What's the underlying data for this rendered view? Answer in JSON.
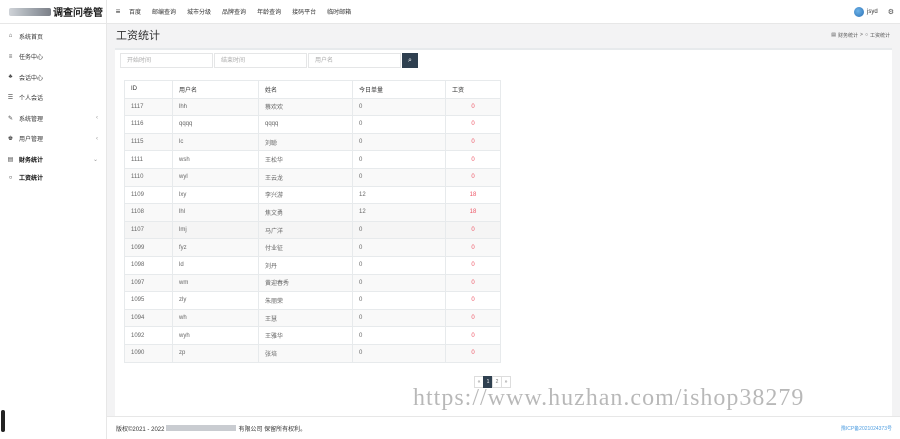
{
  "app": {
    "title": "调查问卷管"
  },
  "topnav": {
    "items": [
      "百度",
      "邮编查询",
      "城市分级",
      "品牌查询",
      "年龄查询",
      "接码平台",
      "临时邮箱"
    ],
    "username": "jsyd"
  },
  "sidebar": {
    "items": [
      {
        "icon": "home-icon",
        "glyph": "⌂",
        "label": "系统首页",
        "arrow": ""
      },
      {
        "icon": "list-icon",
        "glyph": "≡",
        "label": "任务中心",
        "arrow": ""
      },
      {
        "icon": "users-icon",
        "glyph": "♣",
        "label": "会话中心",
        "arrow": ""
      },
      {
        "icon": "list-alt-icon",
        "glyph": "☰",
        "label": "个人会话",
        "arrow": ""
      },
      {
        "icon": "wrench-icon",
        "glyph": "✎",
        "label": "系统管理",
        "arrow": "‹"
      },
      {
        "icon": "users-manage-icon",
        "glyph": "♚",
        "label": "用户管理",
        "arrow": "‹"
      },
      {
        "icon": "finance-icon",
        "glyph": "▤",
        "label": "财务统计",
        "arrow": "⌄"
      }
    ],
    "submenu": [
      {
        "icon": "circle-icon",
        "glyph": "○",
        "label": "工资统计"
      }
    ]
  },
  "page": {
    "title": "工资统计",
    "breadcrumb": {
      "parent": "财务统计",
      "sep": ">",
      "current": "工资统计"
    }
  },
  "search": {
    "start_placeholder": "开始时间",
    "end_placeholder": "结束时间",
    "user_placeholder": "用户名"
  },
  "table": {
    "headers": [
      "ID",
      "用户名",
      "姓名",
      "今日单量",
      "工资"
    ],
    "rows": [
      [
        "1117",
        "lhh",
        "蔡欢欢",
        "0",
        "0"
      ],
      [
        "1116",
        "qqqq",
        "qqqq",
        "0",
        "0"
      ],
      [
        "1115",
        "lc",
        "刘聪",
        "0",
        "0"
      ],
      [
        "1111",
        "wsh",
        "王松华",
        "0",
        "0"
      ],
      [
        "1110",
        "wyl",
        "王云龙",
        "0",
        "0"
      ],
      [
        "1109",
        "lxy",
        "李兴游",
        "12",
        "18"
      ],
      [
        "1108",
        "lhl",
        "焦文勇",
        "12",
        "18"
      ],
      [
        "1107",
        "lmj",
        "马广洋",
        "0",
        "0"
      ],
      [
        "1099",
        "fyz",
        "付业征",
        "0",
        "0"
      ],
      [
        "1098",
        "ld",
        "刘丹",
        "0",
        "0"
      ],
      [
        "1097",
        "wm",
        "黄迎春秀",
        "0",
        "0"
      ],
      [
        "1095",
        "zly",
        "朱丽荣",
        "0",
        "0"
      ],
      [
        "1094",
        "wh",
        "王慧",
        "0",
        "0"
      ],
      [
        "1092",
        "wyh",
        "王雅华",
        "0",
        "0"
      ],
      [
        "1090",
        "zp",
        "张培",
        "0",
        "0"
      ]
    ]
  },
  "pagination": {
    "prev": "«",
    "pages": [
      "1",
      "2"
    ],
    "current": "1",
    "next": "»"
  },
  "watermark": "https://www.huzhan.com/ishop38279",
  "footer": {
    "copyright_prefix": "版权©2021 - 2022",
    "copyright_suffix": "有限公司 保留所有权利。",
    "icp": "豫ICP备2021024373号"
  }
}
